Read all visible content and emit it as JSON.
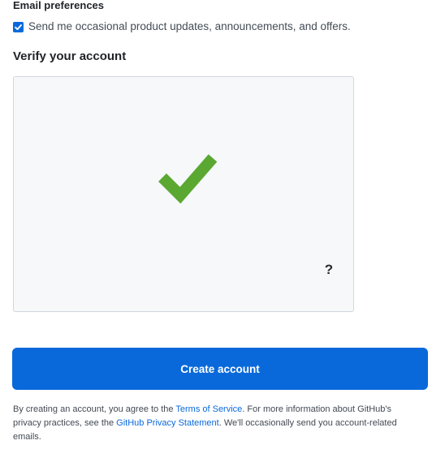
{
  "email_preferences": {
    "heading": "Email preferences",
    "checkbox_checked": true,
    "checkbox_label": "Send me occasional product updates, announcements, and offers."
  },
  "verify": {
    "heading": "Verify your account",
    "status_icon": "checkmark-icon",
    "help_label": "?",
    "accent_color": "#5aa832"
  },
  "actions": {
    "create_account_label": "Create account",
    "button_color": "#0969da"
  },
  "legal": {
    "text_1": "By creating an account, you agree to the ",
    "terms_link": "Terms of Service",
    "text_2": ". For more information about GitHub's privacy practices, see the ",
    "privacy_link": "GitHub Privacy Statement",
    "text_3": ". We'll occasionally send you account-related emails."
  }
}
